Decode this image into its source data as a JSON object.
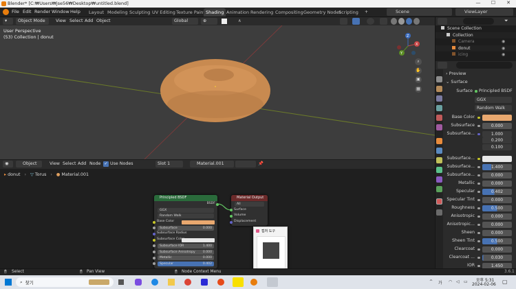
{
  "window": {
    "title": "Blender* [C:₩Users₩jse56₩Desktop₩untitled.blend]",
    "minimize": "—",
    "maximize": "☐",
    "close": "✕"
  },
  "menu": [
    "File",
    "Edit",
    "Render",
    "Window",
    "Help"
  ],
  "workspaces": [
    "Layout",
    "Modeling",
    "Sculpting",
    "UV Editing",
    "Texture Paint",
    "Shading",
    "Animation",
    "Rendering",
    "Compositing",
    "Geometry Nodes",
    "Scripting"
  ],
  "active_workspace": "Shading",
  "scene": {
    "label": "Scene",
    "view_layer": "ViewLayer"
  },
  "viewport_header": {
    "mode": "Object Mode",
    "menus": [
      "View",
      "Select",
      "Add",
      "Object"
    ],
    "orientation": "Global"
  },
  "viewport": {
    "title": "User Perspective",
    "subtitle": "(53) Collection | donut",
    "gizmo": {
      "x": "X",
      "y": "Y",
      "z": "Z"
    }
  },
  "node_header": {
    "editor": "Object",
    "menus": [
      "View",
      "Select",
      "Add",
      "Node"
    ],
    "use_nodes": "Use Nodes",
    "slot": "Slot 1",
    "material": "Material.001"
  },
  "breadcrumb": {
    "object": "donut",
    "mesh": "Torus",
    "material": "Material.001"
  },
  "bsdf_node": {
    "title": "Principled BSDF",
    "output": "BSDF",
    "distribution": "GGX",
    "subsurface_method": "Random Walk",
    "rows": [
      {
        "label": "Base Color",
        "type": "color",
        "color": "#e9a86f"
      },
      {
        "label": "Subsurface",
        "type": "value",
        "value": "0.000"
      },
      {
        "label": "Subsurface Radius",
        "type": "vector"
      },
      {
        "label": "Subsurface Color",
        "type": "color",
        "color": "#e8e8e8"
      },
      {
        "label": "Subsurface IOR",
        "type": "value",
        "value": "1.400"
      },
      {
        "label": "Subsurface Anisotropy",
        "type": "value",
        "value": "0.000"
      },
      {
        "label": "Metallic",
        "type": "value",
        "value": "0.000"
      },
      {
        "label": "Specular",
        "type": "value",
        "value": "0.402"
      }
    ]
  },
  "output_node": {
    "title": "Material Output",
    "target": "All",
    "sockets": [
      "Surface",
      "Volume",
      "Displacement"
    ]
  },
  "popup": {
    "title": "캡처 도구"
  },
  "status": {
    "select": "Select",
    "pan": "Pan View",
    "context": "Node Context Menu",
    "version": "3.6.1"
  },
  "taskbar": {
    "search": "찾기",
    "time": "오후 5:31",
    "date": "2024-02-06"
  },
  "outliner": {
    "search": "",
    "items": [
      {
        "name": "Scene Collection",
        "indent": 0,
        "dim": false
      },
      {
        "name": "Collection",
        "indent": 1,
        "dim": false
      },
      {
        "name": "Camera",
        "indent": 2,
        "dim": true
      },
      {
        "name": "donut",
        "indent": 2,
        "dim": false
      },
      {
        "name": "icing",
        "indent": 2,
        "dim": true
      }
    ]
  },
  "properties": {
    "preview": "Preview",
    "surface_section": "Surface",
    "surface_label": "Surface",
    "surface_value": "Principled BSDF",
    "distribution": "GGX",
    "subsurface_method": "Random Walk",
    "base_color": {
      "label": "Base Color",
      "color": "#e9a86f"
    },
    "subsurface": {
      "label": "Subsurface",
      "value": "0.000"
    },
    "subsurface_radius": {
      "label": "Subsurface...",
      "values": [
        "1.000",
        "0.200",
        "0.100"
      ]
    },
    "subsurface_color": {
      "label": "Subsurface...",
      "color": "#e8e8e8"
    },
    "rows": [
      {
        "label": "Subsurface...",
        "value": "1.400",
        "fill": 0.3
      },
      {
        "label": "Subsurface...",
        "value": "0.000",
        "fill": 0
      },
      {
        "label": "Metallic",
        "value": "0.000",
        "fill": 0
      },
      {
        "label": "Specular",
        "value": "0.402",
        "fill": 0.402
      },
      {
        "label": "Specular Tint",
        "value": "0.000",
        "fill": 0
      },
      {
        "label": "Roughness",
        "value": "0.500",
        "fill": 0.5
      },
      {
        "label": "Anisotropic",
        "value": "0.000",
        "fill": 0
      },
      {
        "label": "Anisotropic...",
        "value": "0.000",
        "fill": 0
      },
      {
        "label": "Sheen",
        "value": "0.000",
        "fill": 0
      },
      {
        "label": "Sheen Tint",
        "value": "0.500",
        "fill": 0.5
      },
      {
        "label": "Clearcoat",
        "value": "0.000",
        "fill": 0
      },
      {
        "label": "Clearcoat ...",
        "value": "0.030",
        "fill": 0.03
      },
      {
        "label": "IOR",
        "value": "1.450",
        "fill": 0
      }
    ]
  },
  "colors": {
    "accent": "#4772b3",
    "donut": "#c88a50",
    "socket_yellow": "#c7c729",
    "socket_grey": "#a1a1a1",
    "socket_purple": "#6363c7",
    "socket_green": "#63c763"
  }
}
